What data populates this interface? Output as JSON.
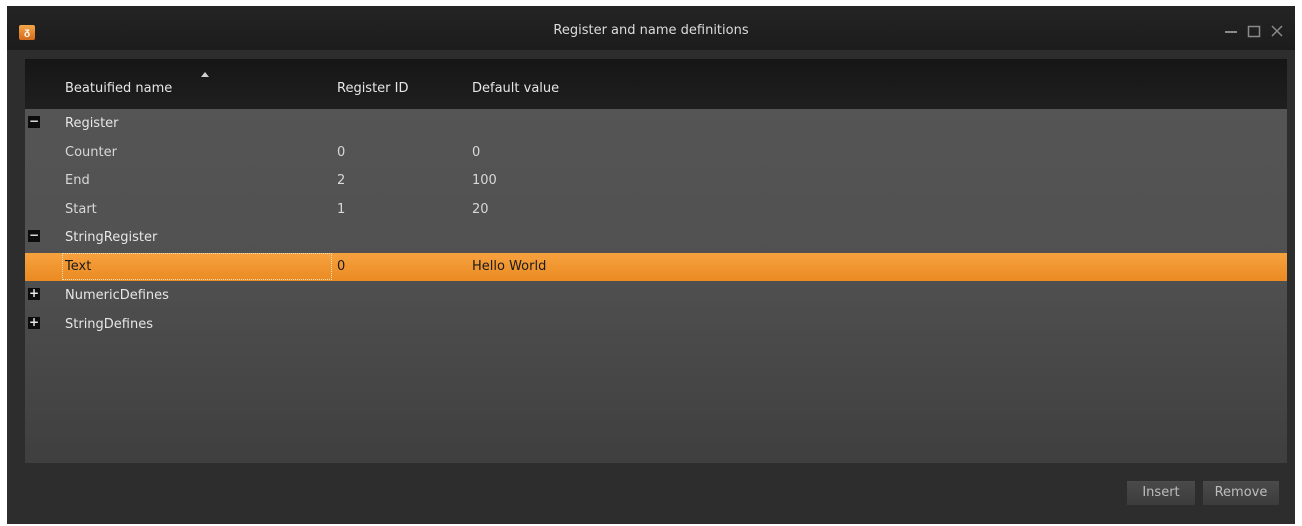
{
  "window": {
    "title": "Register and name definitions",
    "icon": "app-logo-icon"
  },
  "columns": [
    "Beatuified name",
    "Register ID",
    "Default value"
  ],
  "sorted_column": "Beatuified name",
  "groups": [
    {
      "name": "Register",
      "expanded": true,
      "rows": [
        {
          "name": "Counter",
          "id": "0",
          "value": "0"
        },
        {
          "name": "End",
          "id": "2",
          "value": "100"
        },
        {
          "name": "Start",
          "id": "1",
          "value": "20"
        }
      ]
    },
    {
      "name": "StringRegister",
      "expanded": true,
      "rows": [
        {
          "name": "Text",
          "id": "0",
          "value": "Hello World",
          "selected": true
        }
      ]
    },
    {
      "name": "NumericDefines",
      "expanded": false,
      "rows": []
    },
    {
      "name": "StringDefines",
      "expanded": false,
      "rows": []
    }
  ],
  "buttons": {
    "insert": "Insert",
    "remove": "Remove"
  },
  "colors": {
    "selection": "#f39a33",
    "window_bg": "#2d2d2d"
  }
}
